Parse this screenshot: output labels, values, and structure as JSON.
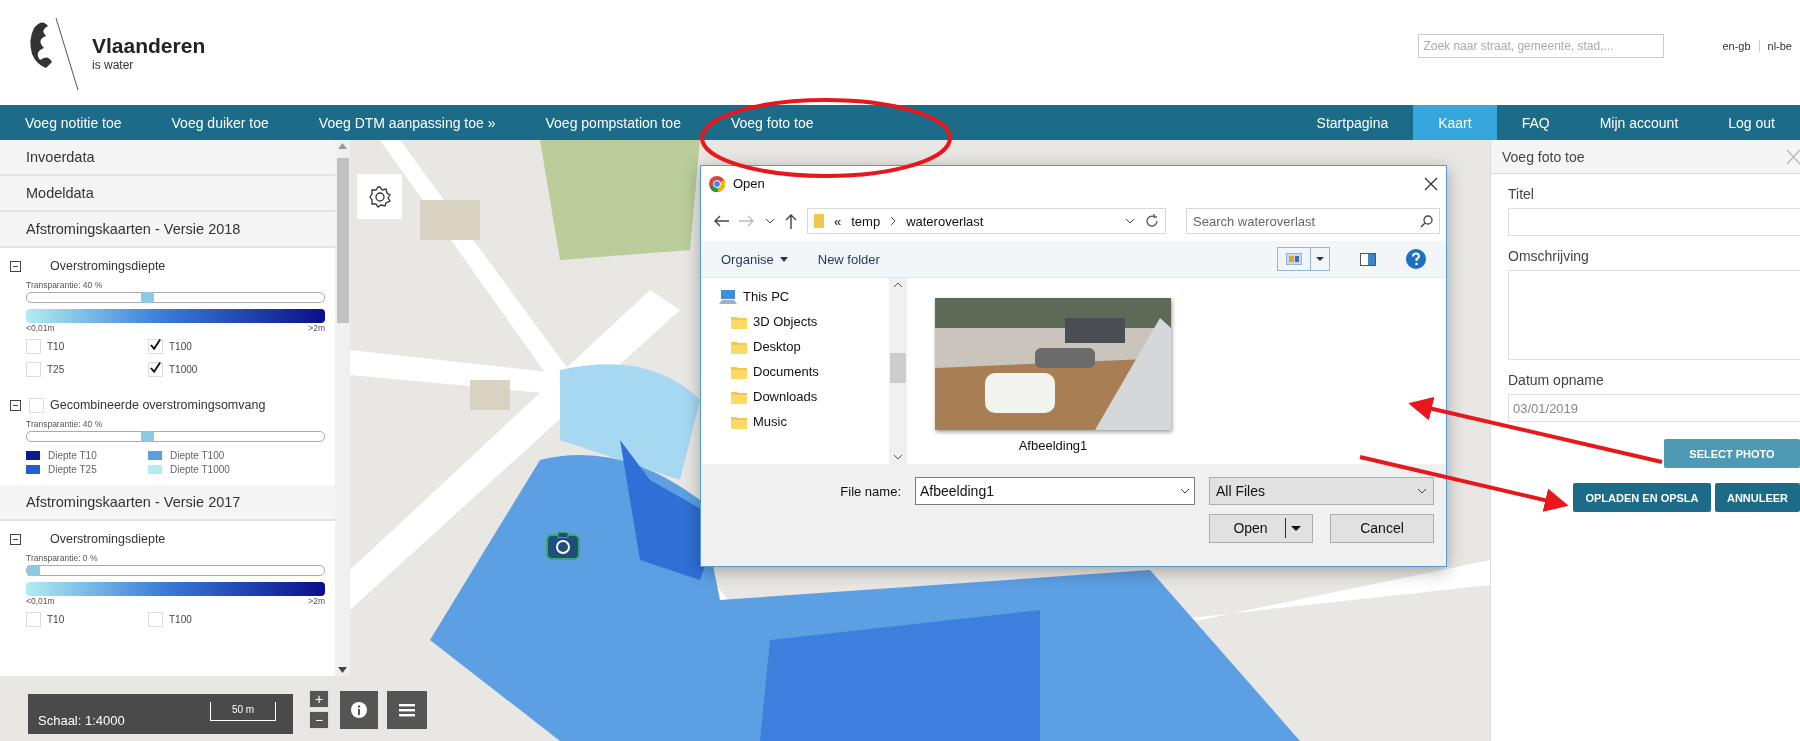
{
  "header": {
    "logo": {
      "title": "Vlaanderen",
      "subtitle": "is water"
    },
    "search": {
      "placeholder": "Zoek naar straat, gemeente, stad,..."
    },
    "languages": [
      {
        "label": "en-gb"
      },
      {
        "label": "nl-be"
      }
    ]
  },
  "nav": {
    "left": [
      {
        "label": "Voeg notitie toe",
        "selected": false
      },
      {
        "label": "Voeg duiker toe",
        "selected": false
      },
      {
        "label": "Voeg DTM aanpassing toe »",
        "selected": false
      },
      {
        "label": "Voeg pompstation toe",
        "selected": false
      },
      {
        "label": "Voeg foto toe",
        "selected": false
      }
    ],
    "right": [
      {
        "label": "Startpagina",
        "selected": false
      },
      {
        "label": "Kaart",
        "selected": true
      },
      {
        "label": "FAQ",
        "selected": false
      },
      {
        "label": "Mijn account",
        "selected": false
      },
      {
        "label": "Log out",
        "selected": false
      }
    ]
  },
  "layer_panel": {
    "sections": [
      {
        "title": "Invoerdata"
      },
      {
        "title": "Modeldata"
      },
      {
        "title": "Afstromingskaarten - Versie 2018",
        "layers": [
          {
            "kind": "depth",
            "name": "Overstromingsdiepte",
            "expanded": true,
            "transparency": "Transparantie: 40 %",
            "level": 0.4,
            "scale_min": "<0,01m",
            "scale_max": ">2m",
            "options": [
              {
                "label": "T10",
                "checked": false
              },
              {
                "label": "T100",
                "checked": true
              },
              {
                "label": "T25",
                "checked": false
              },
              {
                "label": "T1000",
                "checked": true
              }
            ]
          },
          {
            "kind": "extent",
            "name": "Gecombineerde overstromingsomvang",
            "expanded": true,
            "checked": false,
            "transparency": "Transparantie: 40 %",
            "level": 0.4,
            "legend": [
              {
                "label": "Diepte T10",
                "color": "#0b1a8c"
              },
              {
                "label": "Diepte T100",
                "color": "#5b9de0"
              },
              {
                "label": "Diepte T25",
                "color": "#1f5fd0"
              },
              {
                "label": "Diepte T1000",
                "color": "#b4ecf2"
              }
            ]
          }
        ]
      },
      {
        "title": "Afstromingskaarten - Versie 2017",
        "layers": [
          {
            "kind": "depth",
            "name": "Overstromingsdiepte",
            "expanded": true,
            "transparency": "Transparantie: 0 %",
            "level": 0,
            "scale_min": "<0,01m",
            "scale_max": ">2m",
            "options": [
              {
                "label": "T10",
                "checked": false
              },
              {
                "label": "T100",
                "checked": false
              }
            ]
          }
        ]
      }
    ]
  },
  "map": {
    "scale": "Schaal: 1:4000",
    "scale_bar": "50 m",
    "zoom_in": "+",
    "zoom_out": "−"
  },
  "dialog": {
    "title": "Open",
    "path_prefix": "«",
    "path": [
      "temp",
      "wateroverlast"
    ],
    "search": {
      "placeholder": "Search wateroverlast"
    },
    "organise": "Organise",
    "new_folder": "New folder",
    "tree": [
      {
        "label": "This PC",
        "children": [
          {
            "label": "3D Objects"
          },
          {
            "label": "Desktop"
          },
          {
            "label": "Documents"
          },
          {
            "label": "Downloads"
          },
          {
            "label": "Music"
          }
        ]
      }
    ],
    "files": [
      {
        "name": "Afbeelding1",
        "kind": "picture"
      }
    ],
    "file_name_label": "File name:",
    "file_name": "Afbeelding1",
    "file_type": "All Files",
    "open": "Open",
    "cancel": "Cancel"
  },
  "photo_panel": {
    "title": "Voeg foto toe",
    "fields": [
      {
        "label": "Titel",
        "kind": "text"
      },
      {
        "label": "Omschrijving",
        "kind": "textarea"
      },
      {
        "label": "Datum opname",
        "kind": "date",
        "placeholder": "03/01/2019"
      }
    ],
    "select_button": "SELECT PHOTO",
    "buttons": [
      "OPLADEN EN OPSLA",
      "ANNULEER"
    ]
  }
}
